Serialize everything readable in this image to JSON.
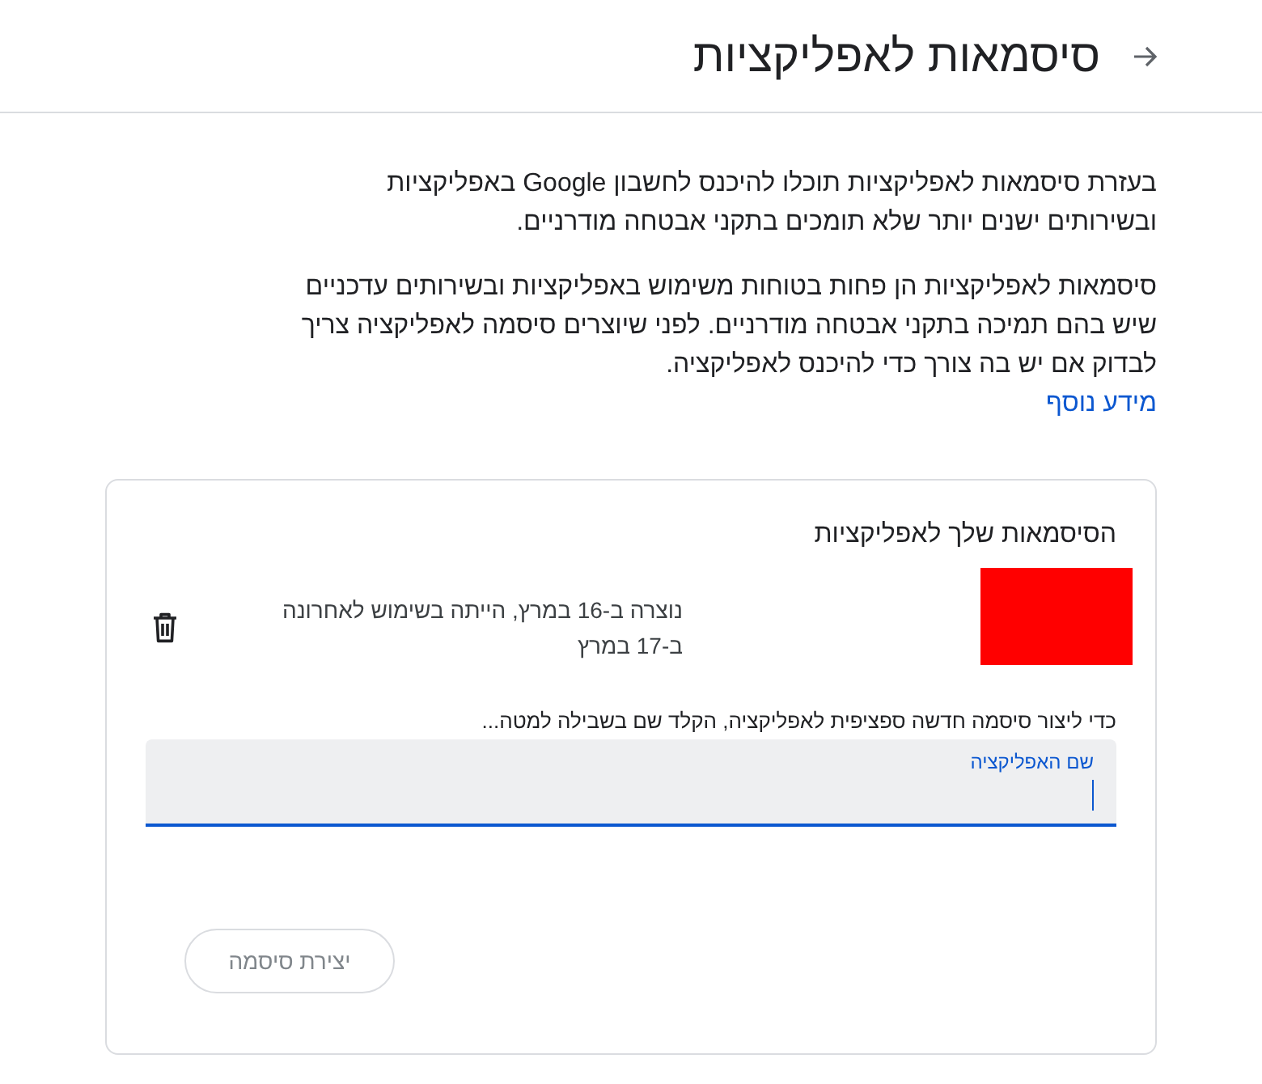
{
  "header": {
    "title": "סיסמאות לאפליקציות"
  },
  "intro": [
    "בעזרת סיסמאות לאפליקציות תוכלו להיכנס לחשבון Google באפליקציות ובשירותים ישנים יותר שלא תומכים בתקני אבטחה מודרניים.",
    "סיסמאות לאפליקציות הן פחות בטוחות משימוש באפליקציות ובשירותים עדכניים שיש בהם תמיכה בתקני אבטחה מודרניים. לפני שיוצרים סיסמה לאפליקציה צריך לבדוק אם יש בה צורך כדי להיכנס לאפליקציה."
  ],
  "learn_more_link": "מידע נוסף",
  "card": {
    "title": "הסיסמאות שלך לאפליקציות",
    "passwords": [
      {
        "details": "נוצרה ב-16 במרץ, הייתה בשימוש לאחרונה ב-17 במרץ"
      }
    ],
    "hint": "כדי ליצור סיסמה חדשה ספציפית לאפליקציה, הקלד שם בשבילה למטה...",
    "app_name_field": {
      "label": "שם האפליקציה",
      "focused": true
    },
    "create_button": {
      "label": "יצירת סיסמה",
      "disabled": true
    }
  }
}
